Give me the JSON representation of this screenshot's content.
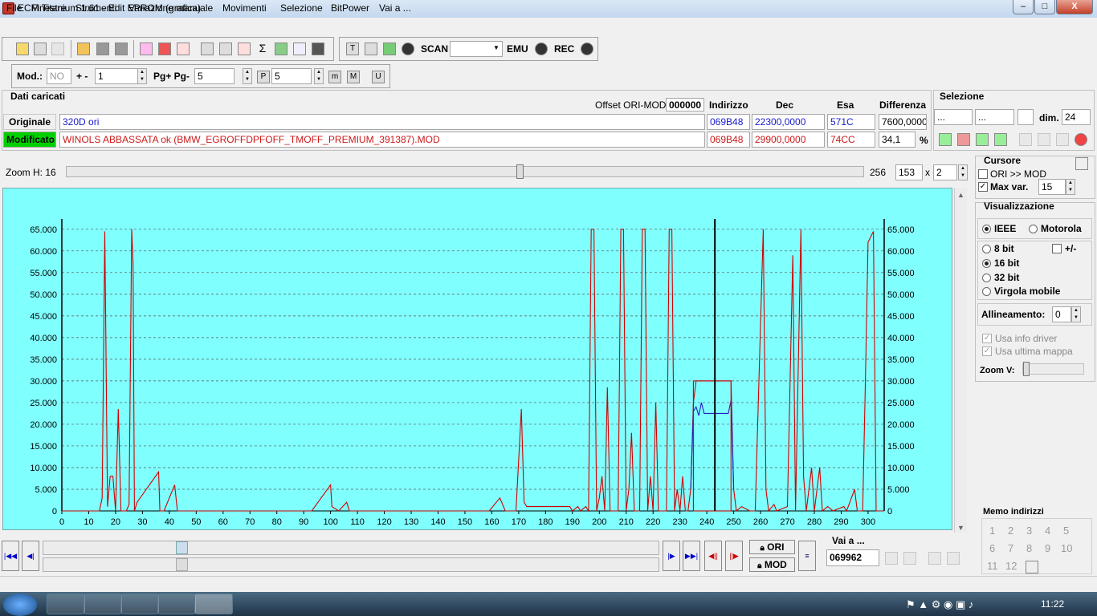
{
  "window": {
    "title": "ECM Titanium 1.61 - Edit EPROM (grafica)",
    "min": "–",
    "max": "□",
    "close": "X"
  },
  "menu": [
    "File",
    "Finestre",
    "Strumenti",
    "Variazione manuale",
    "Movimenti",
    "Selezione",
    "BitPower",
    "Vai a ..."
  ],
  "toolbar": {
    "scan_label": "SCAN",
    "emu_label": "EMU",
    "rec_label": "REC"
  },
  "modbar": {
    "mod_label": "Mod.:",
    "mod_value": "NO",
    "plusminus_label": "+ -",
    "step_value": "1",
    "pg_label": "Pg+ Pg-",
    "pg_value": "5",
    "p_value": "5"
  },
  "loaded": {
    "title": "Dati caricati",
    "offset_label": "Offset ORI-MOD",
    "offset_value": "000000",
    "headers": {
      "address": "Indirizzo",
      "dec": "Dec",
      "hex": "Esa",
      "diff": "Differenza"
    },
    "original": {
      "label": "Originale",
      "file": "320D ori",
      "address": "069B48",
      "dec": "22300,0000",
      "hex": "571C",
      "diff": "7600,0000"
    },
    "modified": {
      "label": "Modificato",
      "file": "WINOLS ABBASSATA ok  (BMW_EGROFFDPFOFF_TMOFF_PREMIUM_391387).MOD",
      "address": "069B48",
      "dec": "29900,0000",
      "hex": "74CC",
      "diff": "34,1",
      "unit": "%"
    }
  },
  "selection": {
    "title": "Selezione",
    "field1": "...",
    "field2": "...",
    "dim_label": "dim.",
    "dim_value": "24"
  },
  "zoom": {
    "label": "Zoom H: 16",
    "max": "256",
    "value": "153",
    "x_label": "x",
    "mult": "2"
  },
  "cursor": {
    "title": "Cursore",
    "ori_mod": "ORI >> MOD",
    "maxvar_label": "Max var.",
    "maxvar_value": "15"
  },
  "display": {
    "title": "Visualizzazione",
    "ieee": "IEEE",
    "motorola": "Motorola",
    "bits8": "8 bit",
    "plusminus": "+/-",
    "bits16": "16 bit",
    "bits32": "32 bit",
    "float": "Virgola mobile",
    "align_label": "Allineamento:",
    "align_value": "0",
    "driver_info": "Usa info driver",
    "last_map": "Usa ultima mappa",
    "zoomv_label": "Zoom V:"
  },
  "memo": {
    "title": "Memo indirizzi",
    "numbers": [
      "1",
      "2",
      "3",
      "4",
      "5",
      "6",
      "7",
      "8",
      "9",
      "10",
      "11",
      "12"
    ]
  },
  "nav": {
    "ori_label": "ORI",
    "mod_label": "MOD",
    "goto_label": "Vai a ...",
    "goto_value": "069962"
  },
  "taskbar": {
    "clock": "11:22"
  },
  "colors": {
    "plot_bg": "#80ffff",
    "original": "#2020c0",
    "modified": "#d00000",
    "accent_green": "#00d000"
  },
  "chart_data": {
    "type": "line",
    "x_ticks": [
      0,
      10,
      20,
      30,
      40,
      50,
      60,
      70,
      80,
      90,
      100,
      110,
      120,
      130,
      140,
      150,
      160,
      170,
      180,
      190,
      200,
      210,
      220,
      230,
      240,
      250,
      260,
      270,
      280,
      290,
      300
    ],
    "y_ticks": [
      "0",
      "5.000",
      "10.000",
      "15.000",
      "20.000",
      "25.000",
      "30.000",
      "35.000",
      "40.000",
      "45.000",
      "50.000",
      "55.000",
      "60.000",
      "65.000"
    ],
    "xlim": [
      0,
      306
    ],
    "ylim": [
      0,
      67000
    ],
    "cursor_x": 243,
    "selection_box": {
      "x_start": 235,
      "x_end": 249,
      "y": 30000
    },
    "series": [
      {
        "key": "modified",
        "points": [
          [
            0,
            0
          ],
          [
            14,
            0
          ],
          [
            15,
            3000
          ],
          [
            16,
            64500
          ],
          [
            17,
            1000
          ],
          [
            18,
            8000
          ],
          [
            19,
            8000
          ],
          [
            20,
            0
          ],
          [
            21,
            23500
          ],
          [
            22,
            0
          ],
          [
            24,
            0
          ],
          [
            25,
            1500
          ],
          [
            26,
            65000
          ],
          [
            26.5,
            57000
          ],
          [
            27,
            0
          ],
          [
            28,
            2000
          ],
          [
            36,
            9000
          ],
          [
            36.5,
            0
          ],
          [
            38,
            0
          ],
          [
            42,
            6000
          ],
          [
            43,
            0
          ],
          [
            93,
            0
          ],
          [
            100,
            6000
          ],
          [
            100.5,
            1000
          ],
          [
            103,
            0
          ],
          [
            106,
            2000
          ],
          [
            107,
            0
          ],
          [
            159,
            0
          ],
          [
            163,
            3000
          ],
          [
            165,
            0
          ],
          [
            169,
            0
          ],
          [
            171,
            23500
          ],
          [
            172,
            2000
          ],
          [
            173,
            1000
          ],
          [
            189,
            1000
          ],
          [
            190,
            0
          ],
          [
            192,
            1000
          ],
          [
            193,
            0
          ],
          [
            195,
            1000
          ],
          [
            196,
            0
          ],
          [
            197,
            65000
          ],
          [
            198,
            65000
          ],
          [
            199,
            0
          ],
          [
            200,
            3000
          ],
          [
            201,
            8000
          ],
          [
            202,
            0
          ],
          [
            203,
            28500
          ],
          [
            204,
            0
          ],
          [
            207,
            0
          ],
          [
            208,
            65000
          ],
          [
            209,
            65000
          ],
          [
            210,
            0
          ],
          [
            211,
            5000
          ],
          [
            212,
            18000
          ],
          [
            213,
            0
          ],
          [
            215,
            0
          ],
          [
            216,
            65000
          ],
          [
            217,
            65000
          ],
          [
            218,
            0
          ],
          [
            219,
            8000
          ],
          [
            220,
            0
          ],
          [
            221,
            25000
          ],
          [
            222,
            0
          ],
          [
            225,
            0
          ],
          [
            226,
            65000
          ],
          [
            227,
            65000
          ],
          [
            228,
            0
          ],
          [
            229,
            5000
          ],
          [
            230,
            0
          ],
          [
            231,
            8000
          ],
          [
            232,
            0
          ],
          [
            233,
            0
          ],
          [
            234,
            5000
          ],
          [
            235,
            25000
          ],
          [
            236,
            30000
          ],
          [
            249,
            30000
          ],
          [
            250,
            5000
          ],
          [
            251,
            0
          ],
          [
            253,
            1000
          ],
          [
            256,
            0
          ],
          [
            258,
            0
          ],
          [
            261,
            65000
          ],
          [
            262,
            5000
          ],
          [
            263,
            0
          ],
          [
            265,
            1500
          ],
          [
            266,
            0
          ],
          [
            270,
            1000
          ],
          [
            272,
            59000
          ],
          [
            273,
            0
          ],
          [
            275,
            65000
          ],
          [
            276,
            8000
          ],
          [
            277,
            0
          ],
          [
            279,
            10000
          ],
          [
            280,
            0
          ],
          [
            282,
            10000
          ],
          [
            283,
            0
          ],
          [
            285,
            1000
          ],
          [
            287,
            0
          ],
          [
            291,
            1000
          ],
          [
            292,
            0
          ],
          [
            295,
            5000
          ],
          [
            296,
            0
          ],
          [
            298,
            0
          ],
          [
            299,
            30000
          ],
          [
            300,
            62000
          ],
          [
            302,
            64500
          ],
          [
            303,
            0
          ],
          [
            306,
            0
          ]
        ]
      },
      {
        "key": "original",
        "points": [
          [
            234,
            5000
          ],
          [
            235,
            23000
          ],
          [
            236,
            24000
          ],
          [
            237,
            22000
          ],
          [
            238,
            25000
          ],
          [
            239,
            22500
          ],
          [
            248,
            22500
          ],
          [
            249,
            25500
          ],
          [
            250,
            5000
          ]
        ]
      }
    ]
  }
}
